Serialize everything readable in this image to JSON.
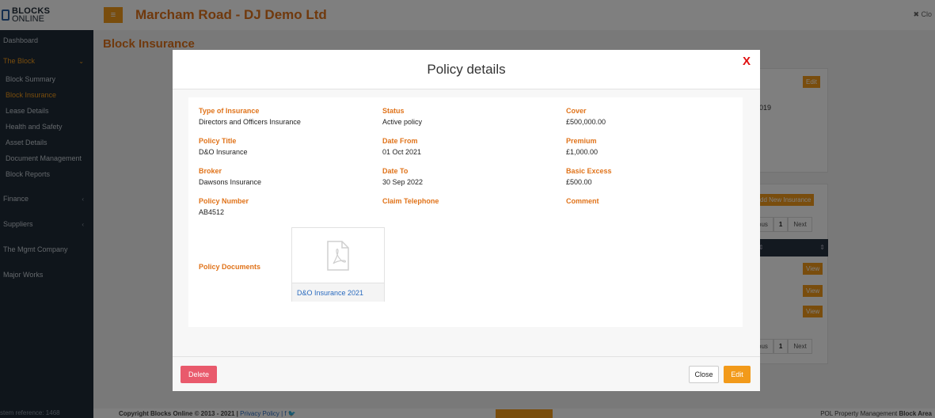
{
  "app": {
    "logo_line1": "BLOCKS",
    "logo_line2": "ONLINE",
    "title": "Marcham Road - DJ Demo Ltd",
    "close_label": "✖ Clo",
    "page_heading": "Block Insurance"
  },
  "sidebar": {
    "items": [
      {
        "label": "Dashboard"
      },
      {
        "label": "The Block",
        "chevron": "⌄"
      },
      {
        "label": "Block Summary"
      },
      {
        "label": "Block Insurance"
      },
      {
        "label": "Lease Details"
      },
      {
        "label": "Health and Safety"
      },
      {
        "label": "Asset Details"
      },
      {
        "label": "Document Management"
      },
      {
        "label": "Block Reports"
      },
      {
        "label": "Finance",
        "chevron": "‹"
      },
      {
        "label": "Suppliers",
        "chevron": "‹"
      },
      {
        "label": "The Mgmt Company"
      },
      {
        "label": "Major Works"
      }
    ],
    "footer": "stem reference: 1468"
  },
  "background": {
    "edit_label": "Edit",
    "partial_year": "019",
    "add_new_label": "dd New Insurance",
    "pager_prev": "ous",
    "pager_current": "1",
    "pager_next": "Next",
    "view_label": "View",
    "sort_icon": "⇕"
  },
  "footer": {
    "copyright": "Copyright Blocks Online © 2013 - 2021 |",
    "privacy": "Privacy Policy |",
    "social": "f 🐦",
    "right_prefix": "POL Property Management ",
    "right_bold": "Block Area"
  },
  "modal": {
    "title": "Policy details",
    "close_x": "X",
    "fields": {
      "type_label": "Type of Insurance",
      "type_value": "Directors and Officers Insurance",
      "status_label": "Status",
      "status_value": "Active policy",
      "cover_label": "Cover",
      "cover_value": "£500,000.00",
      "policy_title_label": "Policy Title",
      "policy_title_value": "D&O Insurance",
      "date_from_label": "Date From",
      "date_from_value": "01 Oct 2021",
      "premium_label": "Premium",
      "premium_value": "£1,000.00",
      "broker_label": "Broker",
      "broker_value": "Dawsons Insurance",
      "date_to_label": "Date To",
      "date_to_value": "30 Sep 2022",
      "excess_label": "Basic Excess",
      "excess_value": "£500.00",
      "policy_number_label": "Policy Number",
      "policy_number_value": "AB4512",
      "claim_tel_label": "Claim Telephone",
      "comment_label": "Comment"
    },
    "documents_label": "Policy Documents",
    "document_name": "D&O Insurance 2021",
    "delete_label": "Delete",
    "close_label": "Close",
    "edit_label": "Edit"
  },
  "colors": {
    "accent": "#f29a1a",
    "heading": "#e0731a",
    "sidebar_bg": "#1f2a36",
    "danger": "#e95a6c",
    "close_x": "#e01010"
  }
}
